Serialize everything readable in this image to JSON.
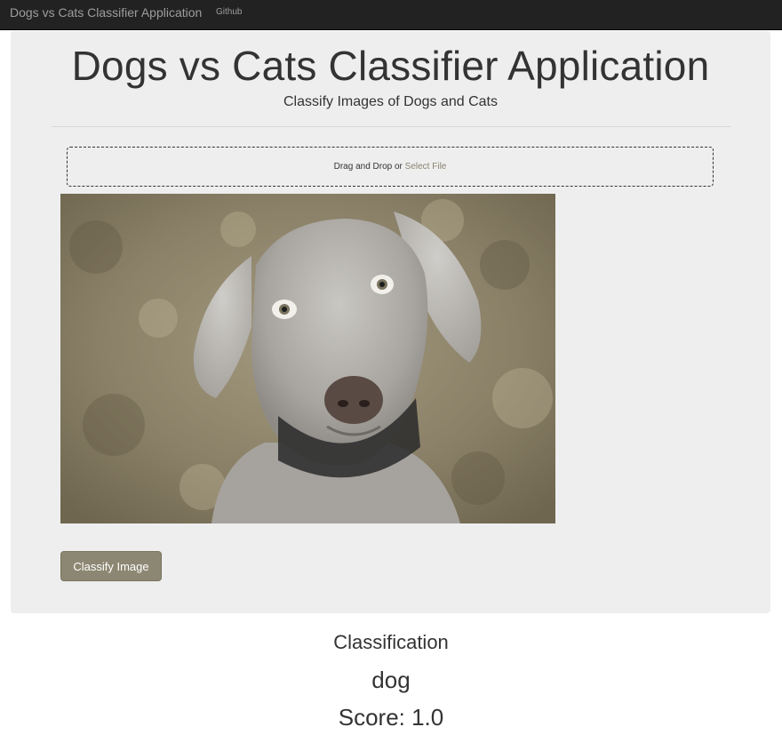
{
  "navbar": {
    "brand": "Dogs vs Cats Classifier Application",
    "links": [
      "Github"
    ]
  },
  "header": {
    "title": "Dogs vs Cats Classifier Application",
    "subtitle": "Classify Images of Dogs and Cats"
  },
  "upload": {
    "prompt": "Drag and Drop or ",
    "select_label": "Select File"
  },
  "preview": {
    "icon": "dog-photo"
  },
  "actions": {
    "classify_label": "Classify Image"
  },
  "result": {
    "heading": "Classification",
    "label": "dog",
    "score": "Score: 1.0"
  },
  "colors": {
    "navbar_bg": "#222222",
    "panel_bg": "#eeeeee",
    "button_bg": "#8c8772",
    "link_accent": "#8a8370"
  }
}
